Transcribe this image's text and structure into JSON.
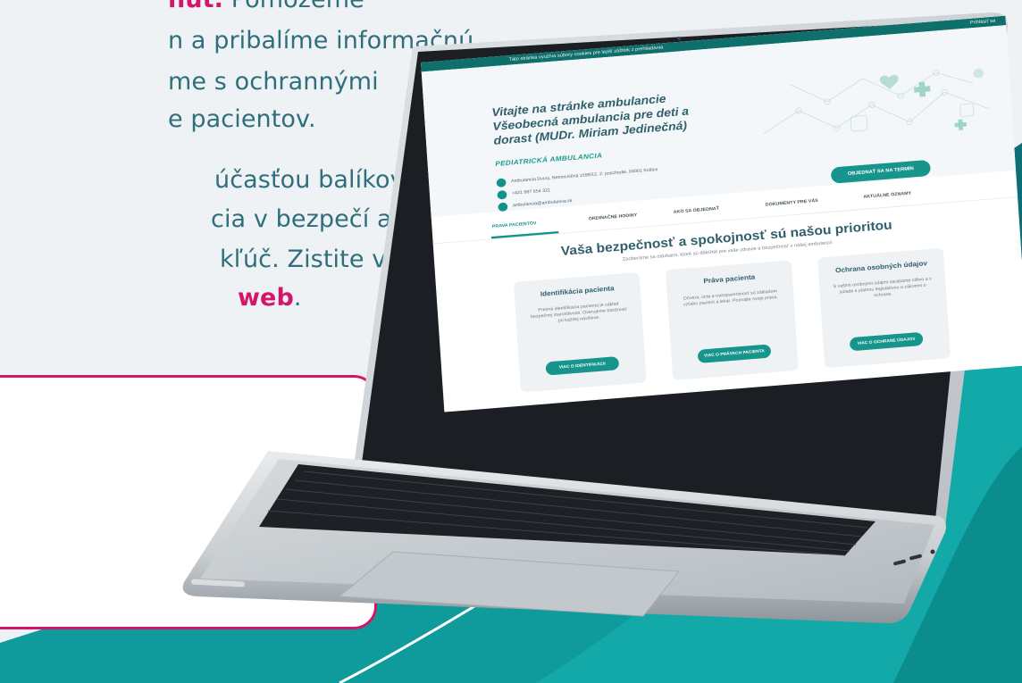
{
  "promo": {
    "line1_prefix": "",
    "line1_highlight": "nút.",
    "line1_rest": " Pomôžeme",
    "line2": "n a pribalíme informačnú",
    "line3": "me s ochrannými",
    "line4": "e pacientov.",
    "line5": "účasťou balíkov",
    "line6": "cia v bezpečí alebo",
    "line7": "kľúč. Zistite viac",
    "line8_highlight": "web",
    "line8_rest": "."
  },
  "site": {
    "topbar_notice": "Táto stránka využíva súbory cookies pre lepší zážitok z prehliadania",
    "topbar_right": "Prihlásiť sa",
    "hero_title": "Vitajte na stránke ambulancie Všeobecná ambulancia pre deti a dorast (MUDr. Miriam Jedinečná)",
    "hero_subtitle": "PEDIATRICKÁ AMBULANCIA",
    "contacts": [
      "Ambulancia Dvory, Nemocničná 1599/12, 2. poschodie, 04001 Košice",
      "+421 987 654 321",
      "ambulancia@ambulancia.sk"
    ],
    "cta_label": "OBJEDNAŤ SA NA TERMÍN",
    "tabs": [
      "PRAVA PACIENTOV",
      "ORDINAČNÉ HODINY",
      "AKO SA OBJEDNAŤ",
      "DOKUMENTY PRE VÁS",
      "AKTUÁLNE OZNAMY"
    ],
    "section_title": "Vaša bezpečnosť a spokojnosť sú našou prioritou",
    "section_subtitle": "Zaoberáme sa otázkami, ktoré sú dôležité pre vaše zdravie a bezpečnosť v našej ambulancii",
    "cards": [
      {
        "title": "Identifikácia pacienta",
        "text": "Presná identifikácia pacienta je základ bezpečnej starostlivosti. Overujeme totožnosť pri každej návšteve.",
        "button": "VIAC O IDENTIFIKÁCII"
      },
      {
        "title": "Práva pacienta",
        "text": "Dôvera, úcta a transparentnosť sú základom vzťahu pacient a lekár. Poznajte svoje práva.",
        "button": "VIAC O PRÁVACH PACIENTA"
      },
      {
        "title": "Ochrana osobných údajov",
        "text": "S vašimi osobnými údajmi narábame citlivo a v súlade s platnou legislatívou a zákonmi o ochrane.",
        "button": "VIAC O OCHRANE ÚDAJOV"
      }
    ]
  }
}
